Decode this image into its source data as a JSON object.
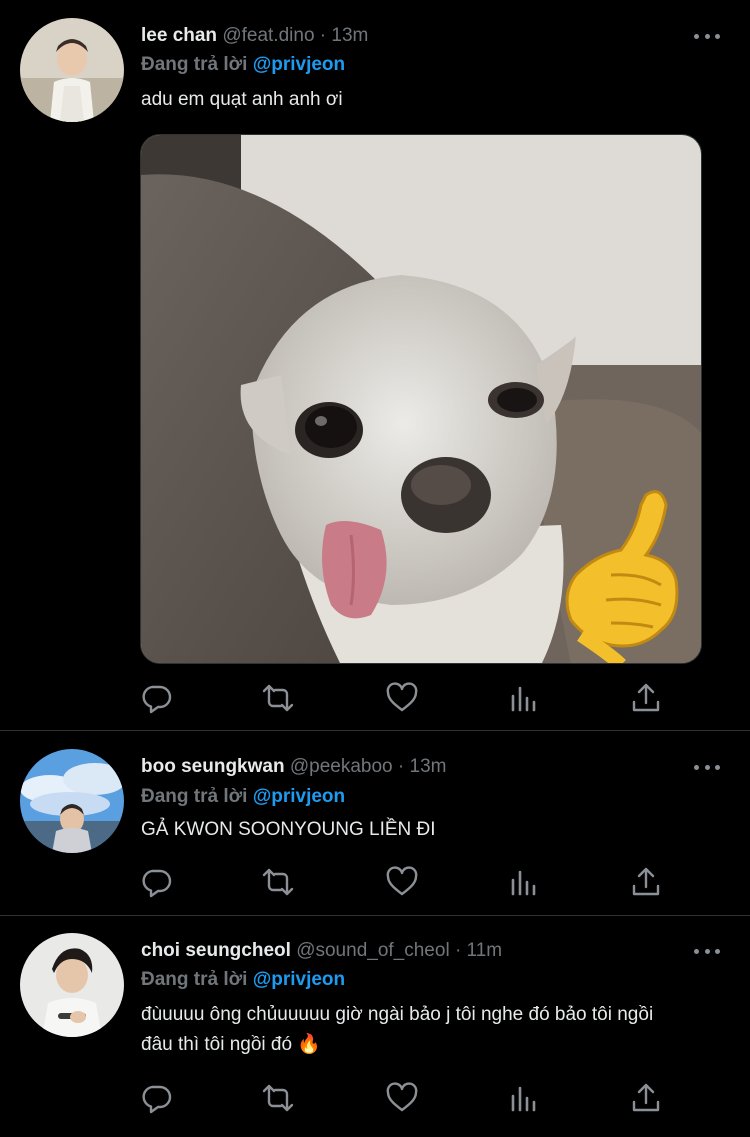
{
  "tweets": [
    {
      "name": "lee chan",
      "meta": "@feat.dino · 13m",
      "reply_prefix": "Đang trả lời",
      "reply_handle": "@privjeon",
      "text": "adu em quạt anh anh ơi"
    },
    {
      "name": "boo seungkwan",
      "meta": "@peekaboo · 13m",
      "reply_prefix": "Đang trả lời",
      "reply_handle": "@privjeon",
      "text": "GẢ KWON SOONYOUNG LIỀN ĐI"
    },
    {
      "name": "choi seungcheol",
      "meta": "@sound_of_cheol · 11m",
      "reply_prefix": "Đang trả lời",
      "reply_handle": "@privjeon",
      "text_line1": "đùuuuu ông chủuuuuu giờ ngài bảo j tôi nghe đó bảo tôi ngồi",
      "text_line2": "đâu thì tôi ngồi đó 🔥"
    }
  ],
  "icons": {
    "reply": "speech-bubble-icon",
    "retweet": "retweet-icon",
    "like": "heart-icon",
    "views": "bar-chart-icon",
    "share": "share-icon",
    "more": "more-dots-icon"
  },
  "colors": {
    "background": "#000000",
    "text": "#e7e9ea",
    "muted": "#71767b",
    "link": "#1d9bf0",
    "divider": "#2f3336"
  }
}
